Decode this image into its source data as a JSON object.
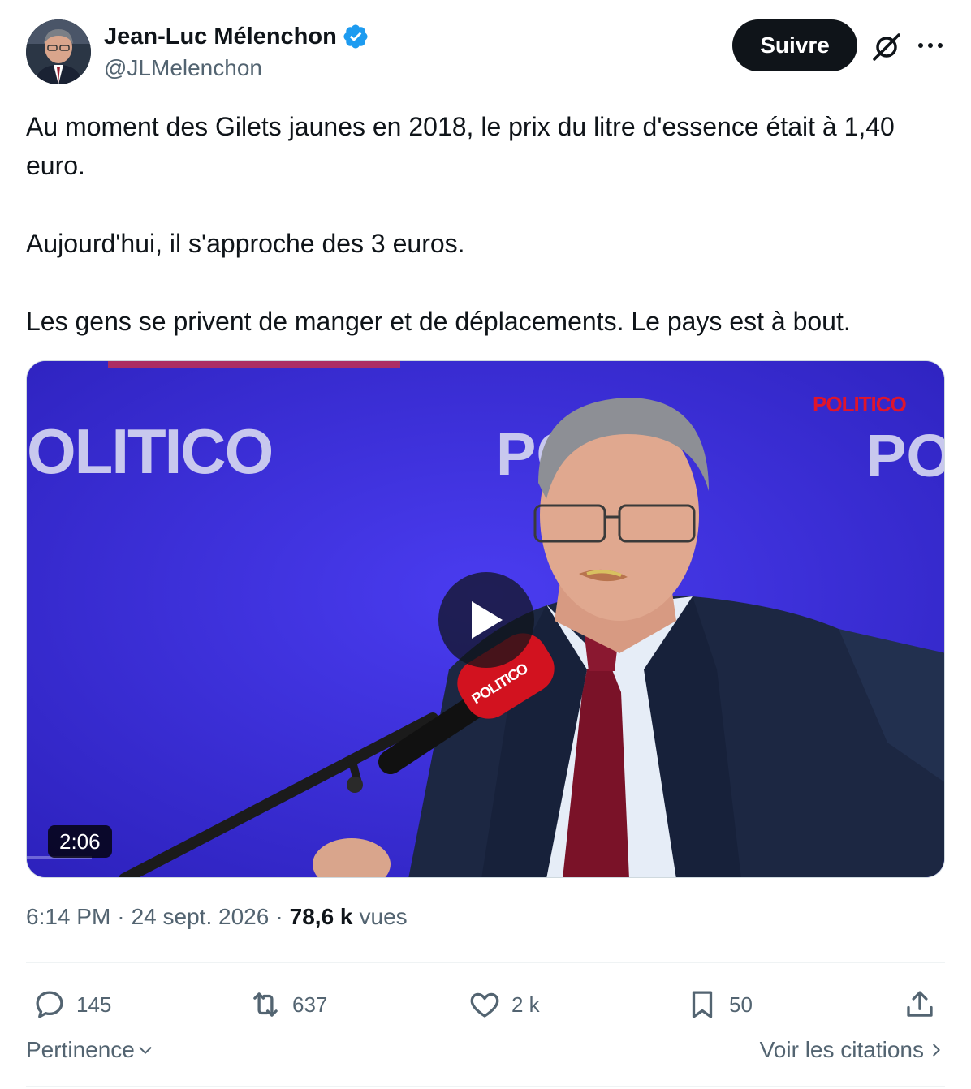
{
  "author": {
    "name": "Jean-Luc Mélenchon",
    "handle": "@JLMelenchon",
    "verified": true
  },
  "header": {
    "follow_label": "Suivre",
    "grok_icon": "grok-icon",
    "more_icon": "more-icon"
  },
  "tweet": {
    "paragraphs": [
      "Au moment des Gilets jaunes en 2018, le prix du litre d'essence était à 1,40 euro.",
      "Aujourd'hui, il s'approche des 3 euros.",
      "Les gens se privent de manger et de déplacements. Le pays est à bout."
    ]
  },
  "media": {
    "backdrop_texts": [
      "OLITICO",
      "PO",
      "PO"
    ],
    "logo_text": "POLITICO",
    "mic_text": "POLITICO",
    "duration": "2:06"
  },
  "meta": {
    "time": "6:14 PM",
    "separator": "·",
    "date": "24 sept. 2026",
    "views_count": "78,6 k",
    "views_label": "vues"
  },
  "actions": {
    "replies": "145",
    "reposts": "637",
    "likes": "2 k",
    "bookmarks": "50"
  },
  "footer": {
    "sort_label": "Pertinence",
    "quotes_label": "Voir les citations"
  },
  "colors": {
    "text_primary": "#0f1419",
    "text_secondary": "#536471",
    "verified_blue": "#1d9bf0",
    "backdrop_blue": "#3b2fd8",
    "politico_red": "#e0152b"
  }
}
